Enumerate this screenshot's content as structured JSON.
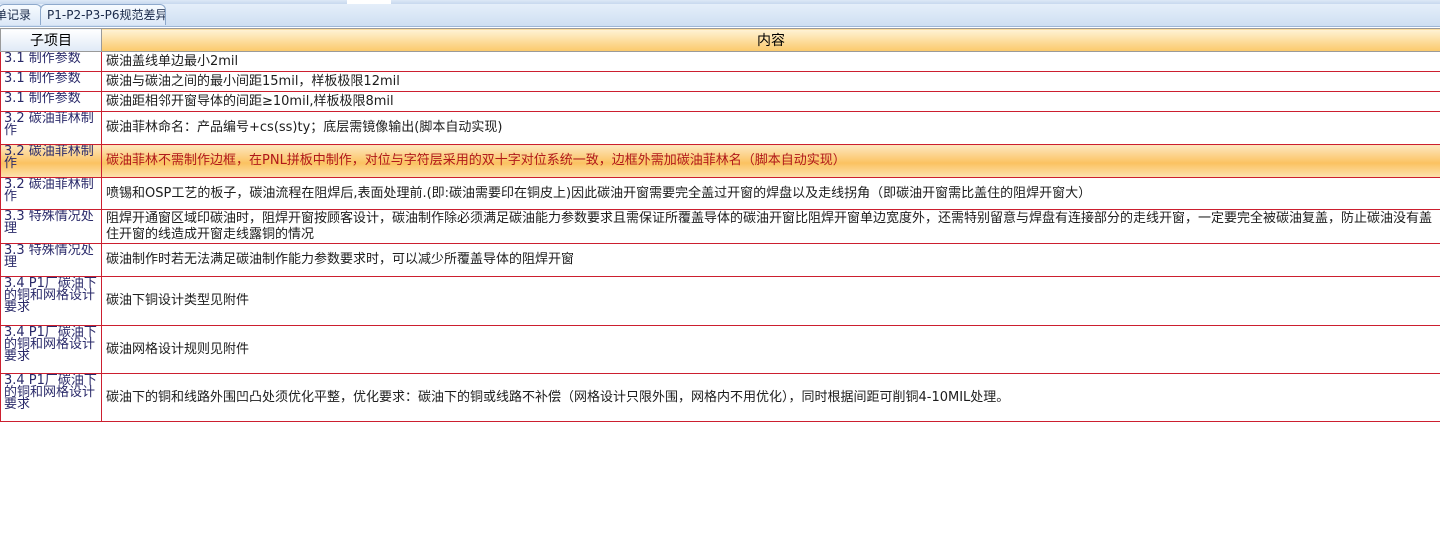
{
  "tabs": [
    {
      "label": "单记录"
    },
    {
      "label": "P1-P2-P3-P6规范差异"
    }
  ],
  "table": {
    "headers": {
      "sub": "子项目",
      "content": "内容"
    },
    "rows": [
      {
        "sub": "3.1 制作参数",
        "content": "碳油盖线单边最小2mil"
      },
      {
        "sub": "3.1 制作参数",
        "content": "碳油与碳油之间的最小间距15mil，样板极限12mil"
      },
      {
        "sub": "3.1 制作参数",
        "content": "碳油距相邻开窗导体的间距≥10mil,样板极限8mil"
      },
      {
        "sub": "3.2 碳油菲林制作",
        "content": "碳油菲林命名：产品编号+cs(ss)ty；底层需镜像输出(脚本自动实现)"
      },
      {
        "sub": "3.2 碳油菲林制作",
        "content": "碳油菲林不需制作边框，在PNL拼板中制作，对位与字符层采用的双十字对位系统一致，边框外需加碳油菲林名（脚本自动实现）"
      },
      {
        "sub": "3.2 碳油菲林制作",
        "content": "喷锡和OSP工艺的板子，碳油流程在阻焊后,表面处理前.(即:碳油需要印在铜皮上)因此碳油开窗需要完全盖过开窗的焊盘以及走线拐角（即碳油开窗需比盖住的阻焊开窗大）"
      },
      {
        "sub": "3.3 特殊情况处理",
        "content": "阻焊开通窗区域印碳油时，阻焊开窗按顾客设计，碳油制作除必须满足碳油能力参数要求且需保证所覆盖导体的碳油开窗比阻焊开窗单边宽度外，还需特别留意与焊盘有连接部分的走线开窗，一定要完全被碳油复盖，防止碳油没有盖住开窗的线造成开窗走线露铜的情况"
      },
      {
        "sub": "3.3 特殊情况处理",
        "content": "碳油制作时若无法满足碳油制作能力参数要求时，可以减少所覆盖导体的阻焊开窗"
      },
      {
        "sub": "3.4 P1厂碳油下的铜和网格设计要求",
        "content": "碳油下铜设计类型见附件"
      },
      {
        "sub": "3.4 P1厂碳油下的铜和网格设计要求",
        "content": "碳油网格设计规则见附件"
      },
      {
        "sub": "3.4 P1厂碳油下的铜和网格设计要求",
        "content": "碳油下的铜和线路外围凹凸处须优化平整，优化要求：碳油下的铜或线路不补偿（网格设计只限外围，网格内不用优化），同时根据间距可削铜4-10MIL处理。"
      }
    ]
  }
}
